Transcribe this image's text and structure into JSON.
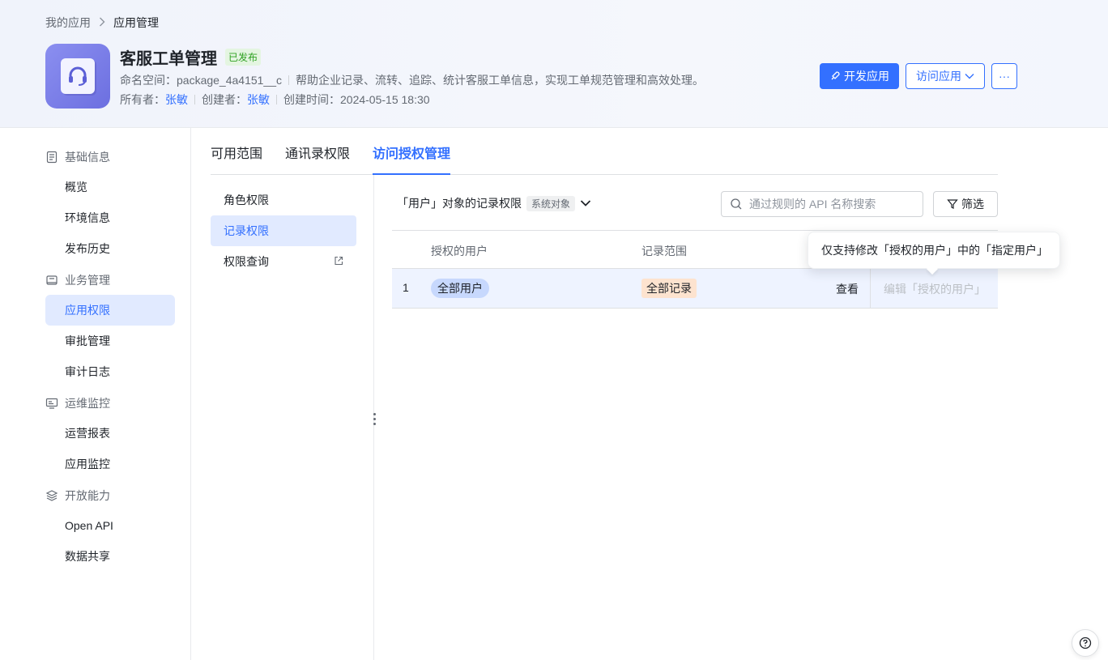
{
  "breadcrumb": {
    "parent": "我的应用",
    "current": "应用管理"
  },
  "app": {
    "title": "客服工单管理",
    "status": "已发布",
    "namespace_label": "命名空间：",
    "namespace_value": "package_4a4151__c",
    "description": "帮助企业记录、流转、追踪、统计客服工单信息，实现工单规范管理和高效处理。",
    "owner_label": "所有者：",
    "owner_value": "张敏",
    "creator_label": "创建者：",
    "creator_value": "张敏",
    "created_label": "创建时间：",
    "created_value": "2024-05-15 18:30"
  },
  "actions": {
    "develop": "开发应用",
    "visit": "访问应用",
    "more": "···"
  },
  "sidebar": {
    "groups": [
      {
        "label": "基础信息",
        "icon": "document-icon"
      },
      {
        "label": "业务管理",
        "icon": "briefcase-icon"
      },
      {
        "label": "运维监控",
        "icon": "monitor-icon"
      },
      {
        "label": "开放能力",
        "icon": "layers-icon"
      }
    ],
    "items": [
      "概览",
      "环境信息",
      "发布历史",
      "应用权限",
      "审批管理",
      "审计日志",
      "运营报表",
      "应用监控",
      "Open API",
      "数据共享"
    ]
  },
  "tabs": [
    "可用范围",
    "通讯录权限",
    "访问授权管理"
  ],
  "subnav": [
    "角色权限",
    "记录权限",
    "权限查询"
  ],
  "object_selector": {
    "label": "「用户」对象的记录权限",
    "tag": "系统对象"
  },
  "search": {
    "placeholder": "通过规则的 API 名称搜索"
  },
  "filter": {
    "label": "筛选"
  },
  "table": {
    "headers": [
      "授权的用户",
      "记录范围"
    ],
    "rows": [
      {
        "index": "1",
        "users": "全部用户",
        "scope": "全部记录",
        "view": "查看",
        "edit": "编辑「授权的用户」"
      }
    ]
  },
  "tooltip": {
    "text": "仅支持修改「授权的用户」中的「指定用户」"
  },
  "colors": {
    "accent": "#3370ff",
    "published": "#2ea121"
  }
}
